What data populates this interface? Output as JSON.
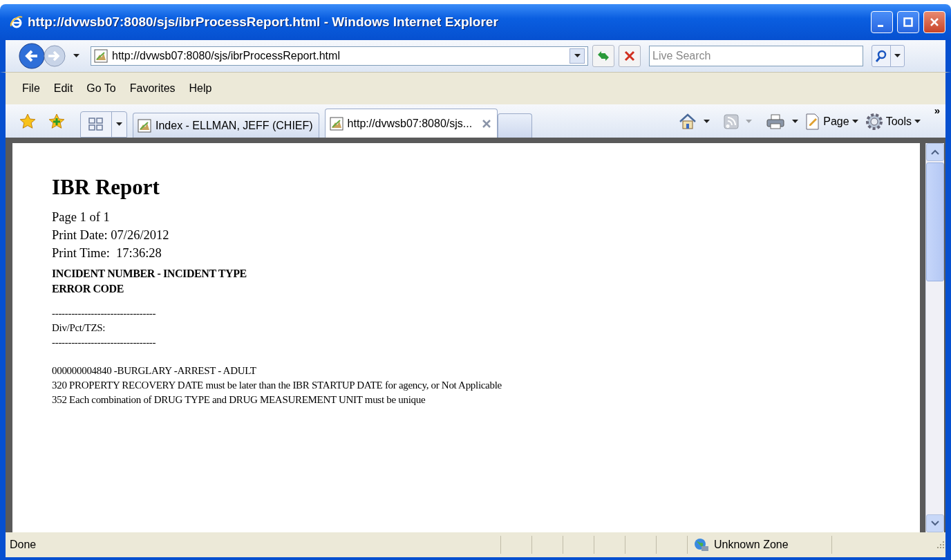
{
  "window": {
    "title": "http://dvwsb07:8080/sjs/ibrProcessReport.html - Windows Internet Explorer"
  },
  "address_bar": {
    "url": "http://dvwsb07:8080/sjs/ibrProcessReport.html"
  },
  "search": {
    "placeholder": "Live Search"
  },
  "menu": [
    "File",
    "Edit",
    "Go To",
    "Favorites",
    "Help"
  ],
  "tabs": [
    {
      "label": "Index - ELLMAN, JEFF (CHIEF)",
      "selected": false
    },
    {
      "label": "http://dvwsb07:8080/sjs...",
      "selected": true
    }
  ],
  "command_bar": {
    "buttons": [
      "Page",
      "Tools"
    ],
    "more": "»"
  },
  "report": {
    "title": "IBR Report",
    "meta": [
      "Page 1 of 1",
      "Print Date: 07/26/2012",
      "Print Time:  17:36:28"
    ],
    "headers": [
      "INCIDENT NUMBER - INCIDENT TYPE",
      "ERROR CODE"
    ],
    "lines": [
      {
        "kind": "rule",
        "text": "--------------------------------"
      },
      {
        "kind": "label",
        "text": "Div/Pct/TZS:"
      },
      {
        "kind": "rule",
        "text": "--------------------------------"
      },
      {
        "kind": "incident",
        "text": "000000004840 -BURGLARY -ARREST - ADULT"
      },
      {
        "kind": "error",
        "text": "320 PROPERTY RECOVERY DATE must be later than the IBR STARTUP DATE for agency, or Not Applicable"
      },
      {
        "kind": "error",
        "text": "352 Each combination of DRUG TYPE and DRUG MEASUREMENT UNIT must be unique"
      }
    ]
  },
  "status_bar": {
    "status": "Done",
    "zone": "Unknown Zone"
  }
}
